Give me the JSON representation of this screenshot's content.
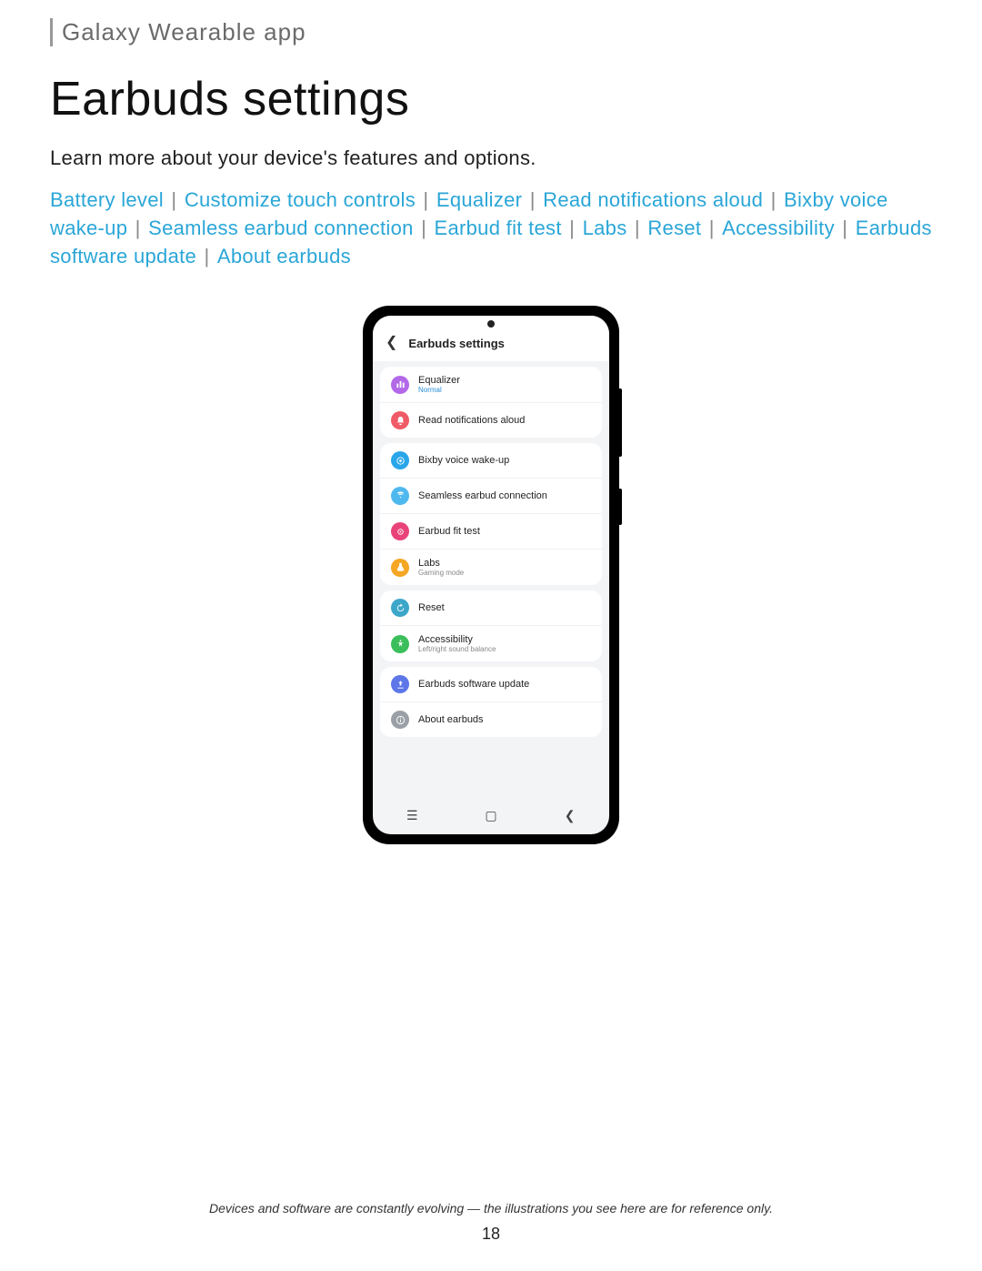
{
  "breadcrumb": "Galaxy Wearable app",
  "title": "Earbuds settings",
  "intro": "Learn more about your device's features and options.",
  "links": [
    "Battery level",
    "Customize touch controls",
    "Equalizer",
    "Read notifications aloud",
    "Bixby voice wake-up",
    "Seamless earbud connection",
    "Earbud fit test",
    "Labs",
    "Reset",
    "Accessibility",
    "Earbuds software update",
    "About earbuds"
  ],
  "phone": {
    "header": "Earbuds settings",
    "groups": [
      [
        {
          "label": "Equalizer",
          "sub": "Normal",
          "subClass": "",
          "icon": "equalizer-icon",
          "color": "c-purple"
        },
        {
          "label": "Read notifications aloud",
          "sub": "",
          "subClass": "",
          "icon": "bell-icon",
          "color": "c-red"
        }
      ],
      [
        {
          "label": "Bixby voice wake-up",
          "sub": "",
          "subClass": "",
          "icon": "bixby-icon",
          "color": "c-blue"
        },
        {
          "label": "Seamless earbud connection",
          "sub": "",
          "subClass": "",
          "icon": "connection-icon",
          "color": "c-sky"
        },
        {
          "label": "Earbud fit test",
          "sub": "",
          "subClass": "",
          "icon": "fit-test-icon",
          "color": "c-pink"
        },
        {
          "label": "Labs",
          "sub": "Gaming mode",
          "subClass": "gray",
          "icon": "labs-icon",
          "color": "c-orange"
        }
      ],
      [
        {
          "label": "Reset",
          "sub": "",
          "subClass": "",
          "icon": "reset-icon",
          "color": "c-teal"
        },
        {
          "label": "Accessibility",
          "sub": "Left/right sound balance",
          "subClass": "gray",
          "icon": "accessibility-icon",
          "color": "c-green"
        }
      ],
      [
        {
          "label": "Earbuds software update",
          "sub": "",
          "subClass": "",
          "icon": "update-icon",
          "color": "c-indigo"
        },
        {
          "label": "About earbuds",
          "sub": "",
          "subClass": "",
          "icon": "info-icon",
          "color": "c-gray"
        }
      ]
    ]
  },
  "footnote": "Devices and software are constantly evolving — the illustrations you see here are for reference only.",
  "pageNumber": "18"
}
